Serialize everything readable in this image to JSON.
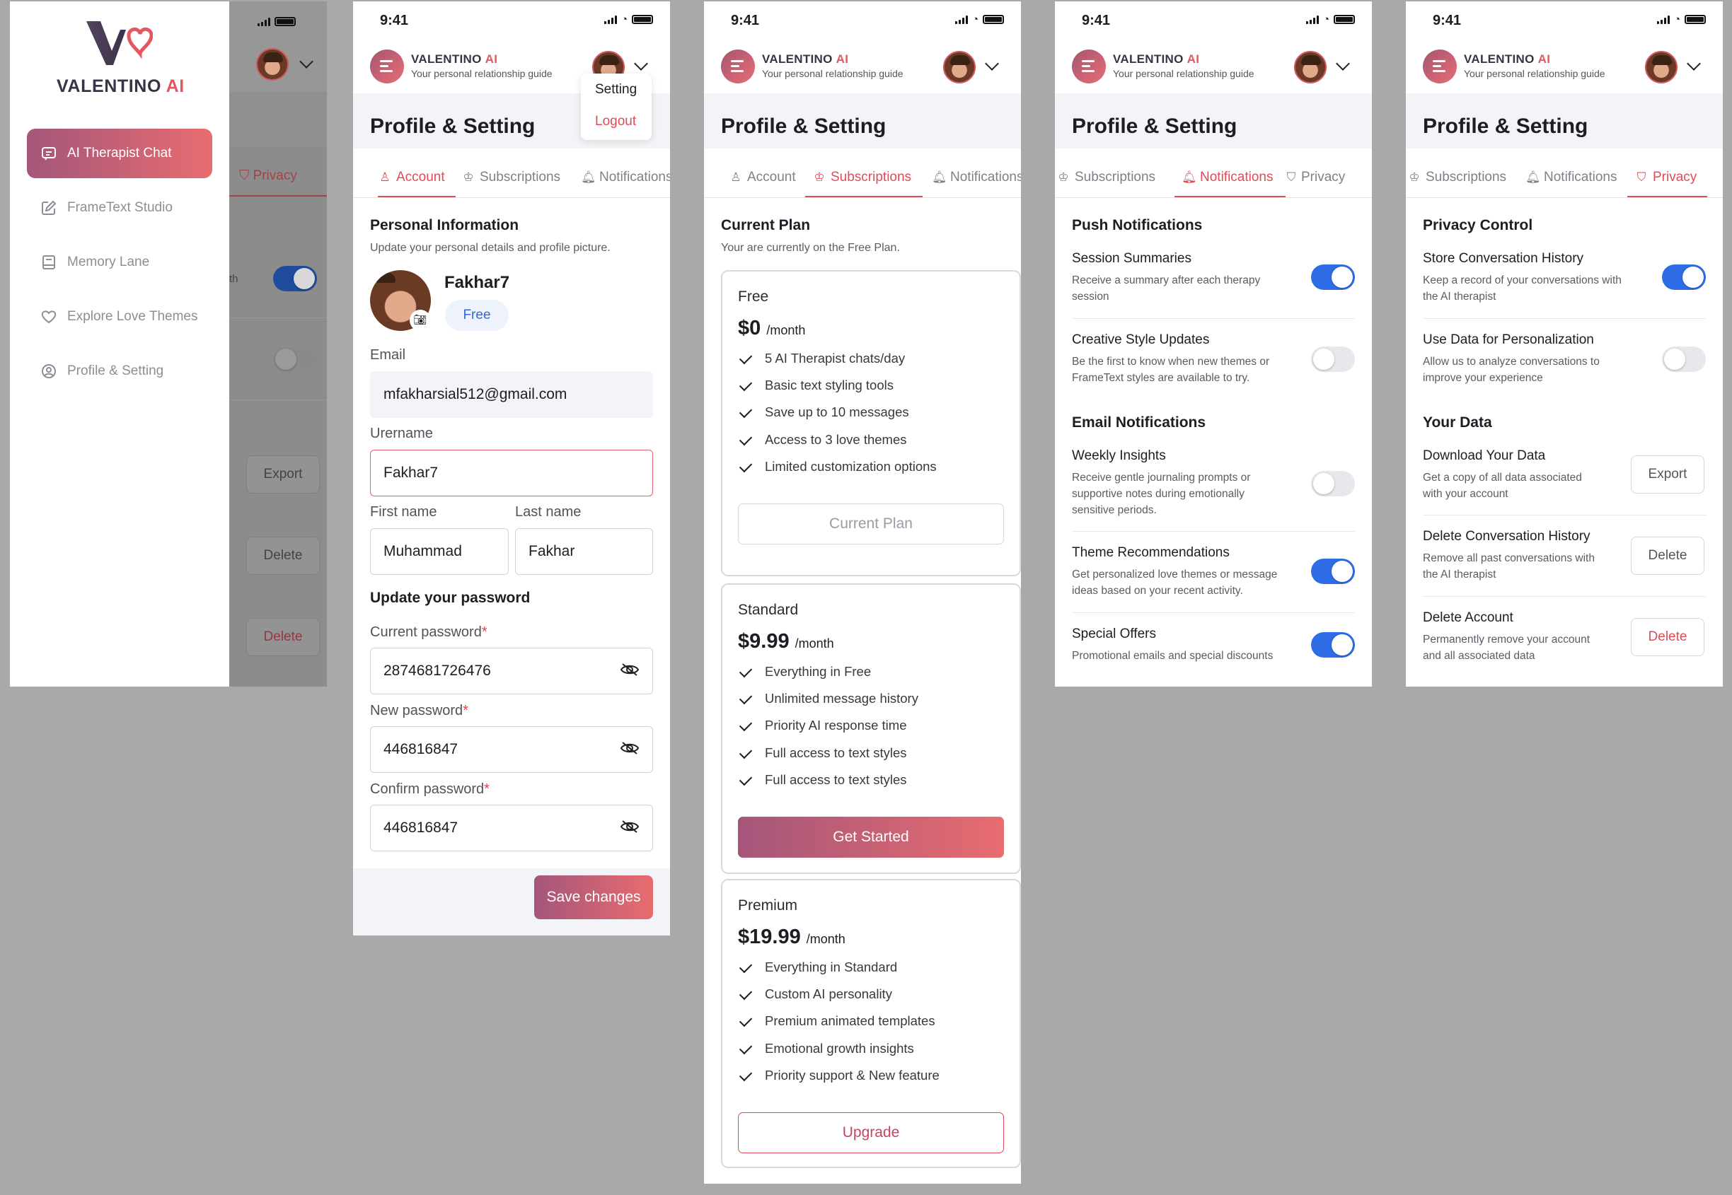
{
  "colors": {
    "accent": "#dd4d57",
    "gradient_start": "#a4567a",
    "gradient_end": "#e86c70",
    "toggle_on": "#2f6de6",
    "page_bg": "#a9a9a9"
  },
  "status": {
    "time": "9:41"
  },
  "brand": {
    "name": "VALENTINO",
    "ai": "AI",
    "tagline": "Your personal relationship guide"
  },
  "page_title": "Profile & Setting",
  "tabs": {
    "account": "Account",
    "subscriptions": "Subscriptions",
    "notifications": "Notifications",
    "privacy": "Privacy"
  },
  "sidebar": {
    "items": [
      {
        "label": "AI Therapist Chat",
        "icon": "chat-icon"
      },
      {
        "label": "FrameText Studio",
        "icon": "edit-icon"
      },
      {
        "label": "Memory Lane",
        "icon": "book-icon"
      },
      {
        "label": "Explore Love Themes",
        "icon": "heart-icon"
      },
      {
        "label": "Profile & Setting",
        "icon": "user-icon"
      }
    ],
    "background": {
      "privacy_tab": "Privacy",
      "toggle_label": "th",
      "export": "Export",
      "delete1": "Delete",
      "delete2": "Delete"
    }
  },
  "dropdown": {
    "setting": "Setting",
    "logout": "Logout"
  },
  "account": {
    "section": "Personal Information",
    "section_sub": "Update your personal details and profile picture.",
    "display_name": "Fakhar7",
    "plan_badge": "Free",
    "email_label": "Email",
    "email_value": "mfakharsial512@gmail.com",
    "username_label": "Urername",
    "username_value": "Fakhar7",
    "first_label": "First name",
    "first_value": "Muhammad",
    "last_label": "Last name",
    "last_value": "Fakhar",
    "password_section": "Update your password",
    "current_label": "Current password",
    "current_value": "2874681726476",
    "new_label": "New password",
    "new_value": "446816847",
    "confirm_label": "Confirm password",
    "confirm_value": "446816847",
    "required_mark": "*",
    "save": "Save changes"
  },
  "subscriptions": {
    "section": "Current Plan",
    "section_sub": "Your are currently on the Free Plan.",
    "plans": [
      {
        "name": "Free",
        "price": "$0",
        "per": "/month",
        "features": [
          "5 AI Therapist chats/day",
          "Basic text styling tools",
          "Save up to 10 messages",
          "Access to 3 love themes",
          "Limited customization options"
        ],
        "button": "Current Plan"
      },
      {
        "name": "Standard",
        "price": "$9.99",
        "per": "/month",
        "features": [
          "Everything in Free",
          "Unlimited message history",
          "Priority AI response time",
          "Full access to text styles",
          "Full access to text styles"
        ],
        "button": "Get Started"
      },
      {
        "name": "Premium",
        "price": "$19.99",
        "per": "/month",
        "features": [
          "Everything in Standard",
          "Custom AI personality",
          "Premium animated templates",
          "Emotional growth insights",
          "Priority support & New feature"
        ],
        "button": "Upgrade"
      }
    ]
  },
  "notifications": {
    "push_section": "Push Notifications",
    "email_section": "Email Notifications",
    "items": [
      {
        "title": "Session Summaries",
        "desc1": "Receive a summary after each therapy",
        "desc2": "session",
        "on": true
      },
      {
        "title": "Creative Style Updates",
        "desc1": "Be the first to know when new themes or",
        "desc2": "FrameText styles are available to try.",
        "on": false
      },
      {
        "title": "Weekly Insights",
        "desc1": "Receive gentle journaling prompts or",
        "desc2": "supportive notes during emotionally",
        "desc3": "sensitive periods.",
        "on": false
      },
      {
        "title": "Theme Recommendations",
        "desc1": "Get personalized love themes or message",
        "desc2": "ideas based on your recent activity.",
        "on": true
      },
      {
        "title": "Special Offers",
        "desc1": "Promotional emails and special discounts",
        "on": true
      }
    ]
  },
  "privacy": {
    "control_section": "Privacy Control",
    "data_section": "Your Data",
    "store_title": "Store Conversation History",
    "store_desc1": "Keep a record of your conversations with",
    "store_desc2": "the AI therapist",
    "store_on": true,
    "use_title": "Use Data for Personalization",
    "use_desc1": "Allow us to analyze conversations to",
    "use_desc2": "improve your experience",
    "use_on": false,
    "download_title": "Download Your Data",
    "download_desc1": "Get a copy of all data associated",
    "download_desc2": "with your account",
    "download_btn": "Export",
    "delhist_title": "Delete Conversation History",
    "delhist_desc1": "Remove all past conversations with",
    "delhist_desc2": "the AI therapist",
    "delhist_btn": "Delete",
    "delacc_title": "Delete Account",
    "delacc_desc1": "Permanently remove your account",
    "delacc_desc2": "and all associated data",
    "delacc_btn": "Delete"
  }
}
